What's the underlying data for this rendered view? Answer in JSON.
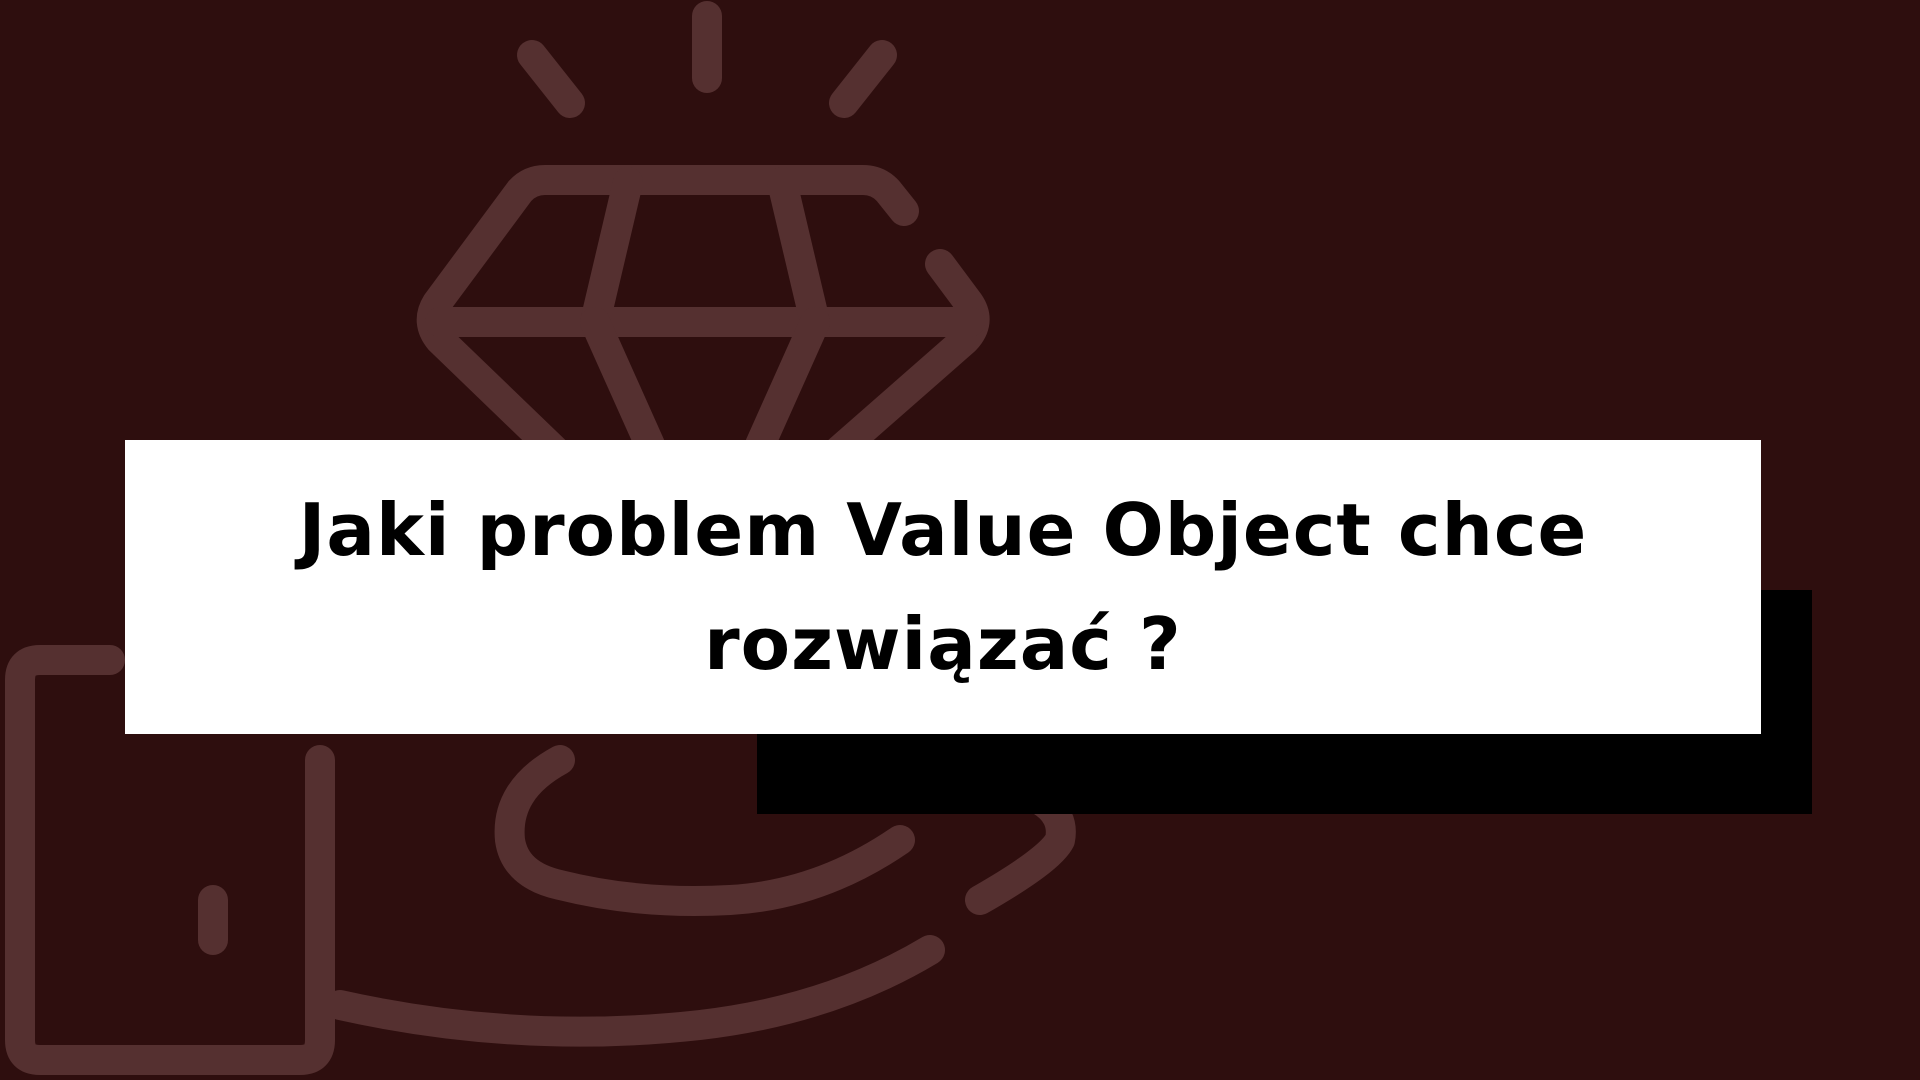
{
  "headline": "Jaki problem Value Object chce rozwiązać ?",
  "colors": {
    "background": "#2e0e0e",
    "illustration": "#553030",
    "card": "#ffffff",
    "card_shadow": "#000000",
    "text": "#000000"
  },
  "icons": {
    "background": "hand-holding-diamond-icon"
  }
}
